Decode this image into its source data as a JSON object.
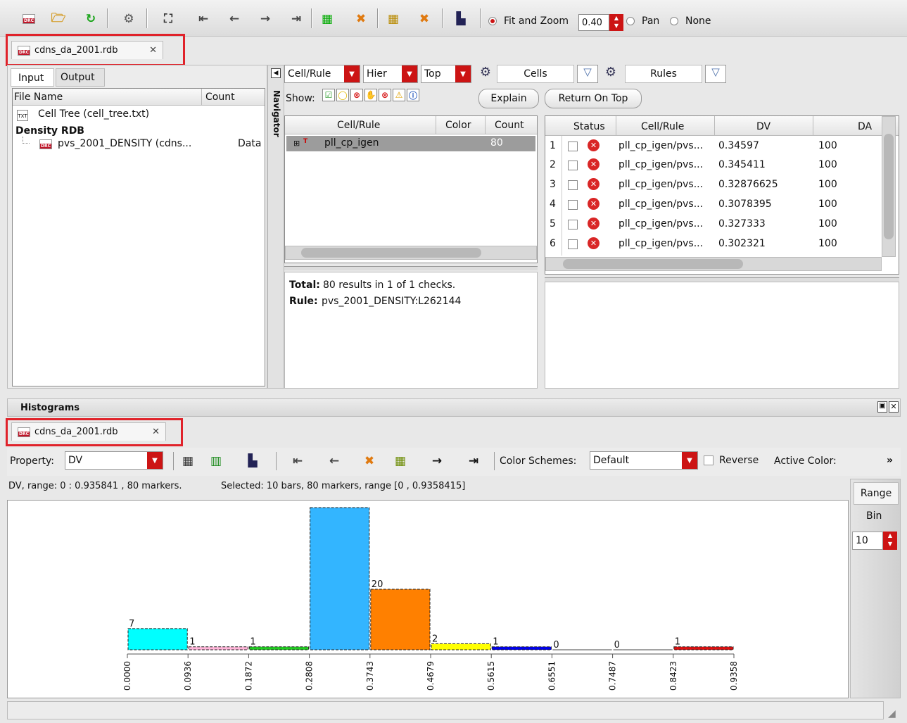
{
  "toolbar": {
    "fit_zoom_label": "Fit and Zoom",
    "zoom_value": "0.40",
    "pan_label": "Pan",
    "none_label": "None"
  },
  "top_tab": {
    "label": "cdns_da_2001.rdb",
    "close": "✕"
  },
  "left_panel": {
    "tabs": [
      "Input",
      "Output"
    ],
    "col_file_name": "File Name",
    "col_count": "Count",
    "cell_tree_label": "Cell Tree (cell_tree.txt)",
    "density_rdb_label": "Density RDB",
    "density_item_label": "pvs_2001_DENSITY (cdns...",
    "density_item_count": "Data",
    "navigator_label": "Navigator"
  },
  "center_panel": {
    "cellrule_dd": "Cell/Rule",
    "hier_dd": "Hier",
    "top_dd": "Top",
    "cells_label": "Cells",
    "rules_label": "Rules",
    "show_label": "Show:",
    "explain_btn": "Explain",
    "return_btn": "Return On Top",
    "grid_headers": [
      "Cell/Rule",
      "Color",
      "Count"
    ],
    "grid_row": {
      "name": "pll_cp_igen",
      "count": "80"
    },
    "total_label": "Total:",
    "total_text": "80 results in 1 of 1 checks.",
    "rule_label": "Rule:",
    "rule_text": "pvs_2001_DENSITY:L262144"
  },
  "results_grid": {
    "headers": [
      "Status",
      "Cell/Rule",
      "DV",
      "DA"
    ],
    "rows": [
      {
        "n": "1",
        "cell": "pll_cp_igen/pvs...",
        "dv": "0.34597",
        "da": "100"
      },
      {
        "n": "2",
        "cell": "pll_cp_igen/pvs...",
        "dv": "0.345411",
        "da": "100"
      },
      {
        "n": "3",
        "cell": "pll_cp_igen/pvs...",
        "dv": "0.32876625",
        "da": "100"
      },
      {
        "n": "4",
        "cell": "pll_cp_igen/pvs...",
        "dv": "0.3078395",
        "da": "100"
      },
      {
        "n": "5",
        "cell": "pll_cp_igen/pvs...",
        "dv": "0.327333",
        "da": "100"
      },
      {
        "n": "6",
        "cell": "pll_cp_igen/pvs...",
        "dv": "0.302321",
        "da": "100"
      }
    ]
  },
  "histograms": {
    "title": "Histograms",
    "tab_label": "cdns_da_2001.rdb",
    "property_label": "Property:",
    "property_value": "DV",
    "color_schemes_label": "Color Schemes:",
    "color_scheme_value": "Default",
    "reverse_label": "Reverse",
    "active_color_label": "Active Color:",
    "more": "»",
    "info_left": "DV, range: 0 : 0.935841 , 80 markers.",
    "info_right": "Selected: 10 bars, 80 markers, range [0 , 0.9358415]",
    "range_btn": "Range",
    "bin_label": "Bin",
    "bin_value": "10"
  },
  "chart_data": {
    "type": "bar",
    "categories": [
      "0.0000",
      "0.0936",
      "0.1872",
      "0.2808",
      "0.3743",
      "0.4679",
      "0.5615",
      "0.6551",
      "0.7487",
      "0.8423"
    ],
    "tick_labels": [
      "0.0000",
      "0.0936",
      "0.1872",
      "0.2808",
      "0.3743",
      "0.4679",
      "0.5615",
      "0.6551",
      "0.7487",
      "0.8423",
      "0.9358"
    ],
    "values": [
      7,
      1,
      1,
      47,
      20,
      2,
      1,
      0,
      0,
      1
    ],
    "data_labels": [
      "7",
      "1",
      "1",
      "",
      "20",
      "2",
      "1",
      "0",
      "0",
      "1"
    ],
    "colors": [
      "#00ffff",
      "#ffb6d9",
      "#22cc22",
      "#33b5ff",
      "#ff8000",
      "#ffff00",
      "#0000ee",
      "#444444",
      "#444444",
      "#dd1111"
    ],
    "xlim": [
      0,
      0.9358
    ],
    "ylim": [
      0,
      47
    ]
  }
}
